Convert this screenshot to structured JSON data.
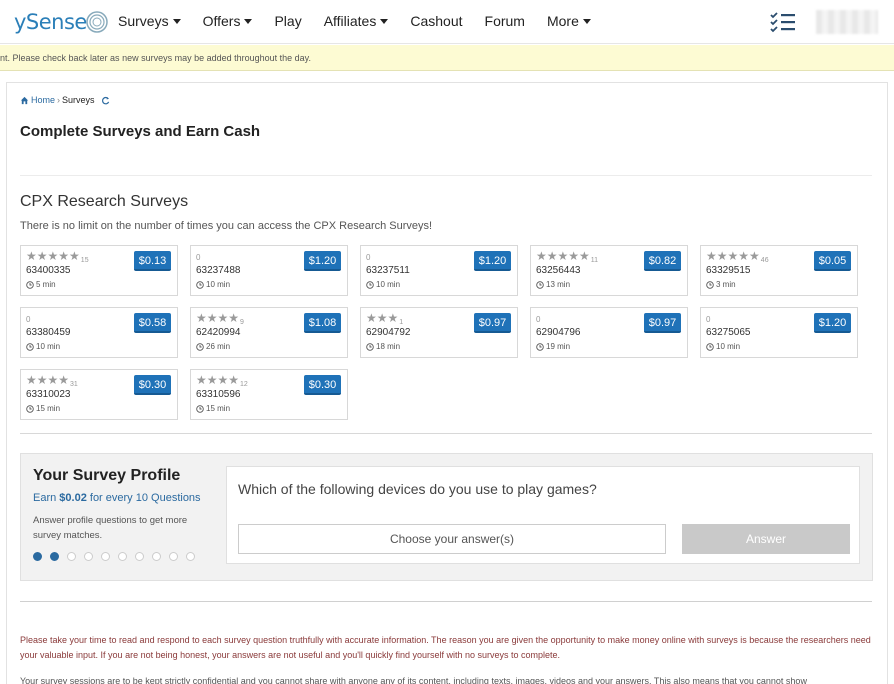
{
  "nav": {
    "logo_text": "ySense",
    "items": [
      {
        "label": "Surveys",
        "dropdown": true
      },
      {
        "label": "Offers",
        "dropdown": true
      },
      {
        "label": "Play",
        "dropdown": false
      },
      {
        "label": "Affiliates",
        "dropdown": true
      },
      {
        "label": "Cashout",
        "dropdown": false
      },
      {
        "label": "Forum",
        "dropdown": false
      },
      {
        "label": "More",
        "dropdown": true
      }
    ]
  },
  "notice": "nt. Please check back later as new surveys may be added throughout the day.",
  "breadcrumb": {
    "home": "Home",
    "current": "Surveys"
  },
  "page_title": "Complete Surveys and Earn Cash",
  "section": {
    "title": "CPX Research Surveys",
    "subtitle": "There is no limit on the number of times you can access the CPX Research Surveys!"
  },
  "surveys": [
    {
      "id": "63400335",
      "price": "$0.13",
      "stars": 5,
      "rating_count": "15",
      "time": "5 min"
    },
    {
      "id": "63237488",
      "price": "$1.20",
      "stars": 0,
      "rating_count": "0",
      "time": "10 min"
    },
    {
      "id": "63237511",
      "price": "$1.20",
      "stars": 0,
      "rating_count": "0",
      "time": "10 min"
    },
    {
      "id": "63256443",
      "price": "$0.82",
      "stars": 5,
      "rating_count": "11",
      "time": "13 min"
    },
    {
      "id": "63329515",
      "price": "$0.05",
      "stars": 5,
      "rating_count": "46",
      "time": "3 min"
    },
    {
      "id": "63380459",
      "price": "$0.58",
      "stars": 0,
      "rating_count": "0",
      "time": "10 min"
    },
    {
      "id": "62420994",
      "price": "$1.08",
      "stars": 4,
      "rating_count": "9",
      "time": "26 min"
    },
    {
      "id": "62904792",
      "price": "$0.97",
      "stars": 3,
      "rating_count": "1",
      "time": "18 min"
    },
    {
      "id": "62904796",
      "price": "$0.97",
      "stars": 0,
      "rating_count": "0",
      "time": "19 min"
    },
    {
      "id": "63275065",
      "price": "$1.20",
      "stars": 0,
      "rating_count": "0",
      "time": "10 min"
    },
    {
      "id": "63310023",
      "price": "$0.30",
      "stars": 4,
      "rating_count": "31",
      "time": "15 min"
    },
    {
      "id": "63310596",
      "price": "$0.30",
      "stars": 4,
      "rating_count": "12",
      "time": "15 min"
    }
  ],
  "profile": {
    "title": "Your Survey Profile",
    "earn_prefix": "Earn ",
    "earn_amount": "$0.02",
    "earn_suffix": " for every 10 Questions",
    "description": "Answer profile questions to get more survey matches.",
    "progress_filled": 2,
    "progress_total": 10,
    "question": "Which of the following devices do you use to play games?",
    "select_placeholder": "Choose your answer(s)",
    "answer_label": "Answer"
  },
  "footer": {
    "warning": "Please take your time to read and respond to each survey question truthfully with accurate information. The reason you are given the opportunity to make money online with surveys is because the researchers need your valuable input. If you are not being honest, your answers are not useful and you'll quickly find yourself with no surveys to complete.",
    "privacy": "Your survey sessions are to be kept strictly confidential and you cannot share with anyone any of its content, including texts, images, videos and your answers. This also means that you cannot show"
  },
  "colors": {
    "brand": "#2b7fb8",
    "price_button": "#1f72b8",
    "notice_bg": "#fdfbd3",
    "warning_text": "#8a3a3a"
  }
}
